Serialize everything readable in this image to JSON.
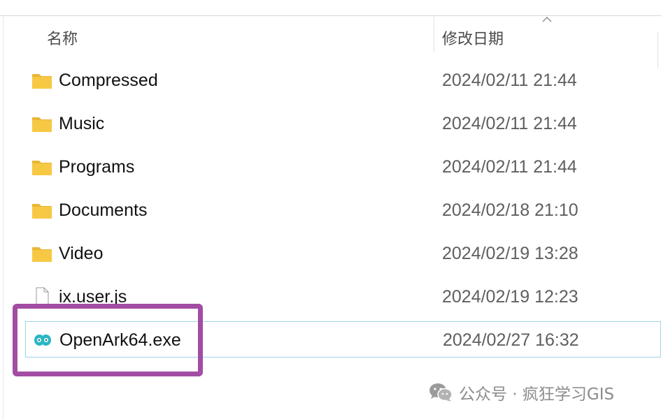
{
  "columns": {
    "name_label": "名称",
    "date_label": "修改日期"
  },
  "rows": [
    {
      "name": "Compressed",
      "date": "2024/02/11 21:44",
      "icon": "folder-icon"
    },
    {
      "name": "Music",
      "date": "2024/02/11 21:44",
      "icon": "folder-icon"
    },
    {
      "name": "Programs",
      "date": "2024/02/11 21:44",
      "icon": "folder-icon"
    },
    {
      "name": "Documents",
      "date": "2024/02/18 21:10",
      "icon": "folder-icon"
    },
    {
      "name": "Video",
      "date": "2024/02/19 13:28",
      "icon": "folder-icon"
    },
    {
      "name": "ix.user.js",
      "date": "2024/02/19 12:23",
      "icon": "file-icon"
    },
    {
      "name": "OpenArk64.exe",
      "date": "2024/02/27 16:32",
      "icon": "openark-icon",
      "selected": true
    }
  ],
  "watermark": {
    "text": "公众号 · 疯狂学习GIS",
    "icon": "wechat-icon"
  },
  "colors": {
    "highlight": "#a34ca3",
    "selection_border": "#9fd3ea",
    "folder": "#f7c843",
    "openark": "#2bb7c4"
  }
}
